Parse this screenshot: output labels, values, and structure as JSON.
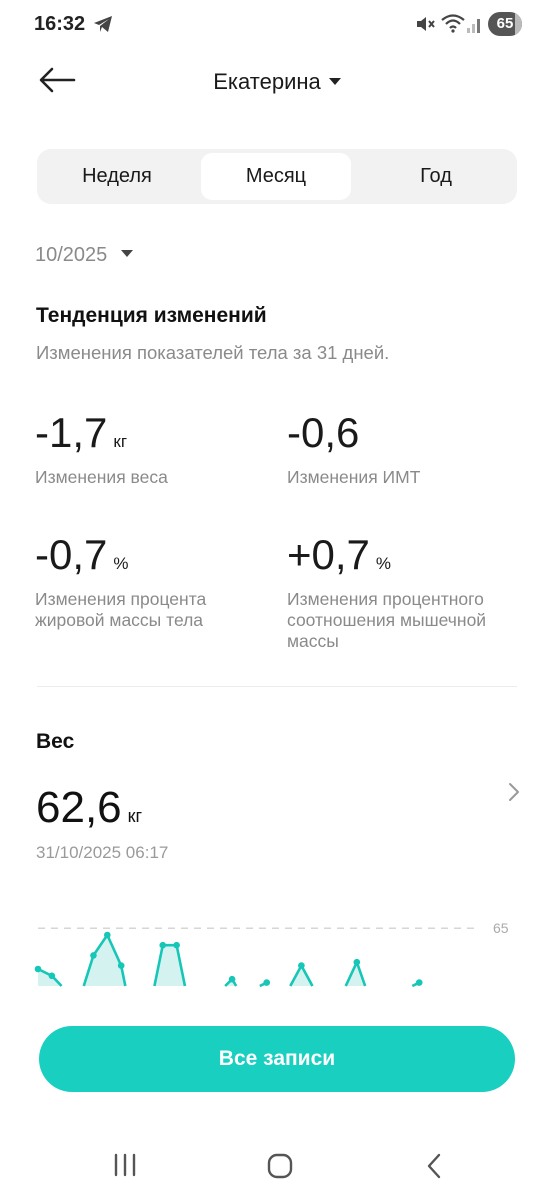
{
  "status": {
    "time": "16:32",
    "battery": "65",
    "icons": [
      "telegram-icon",
      "mute-icon",
      "wifi-icon",
      "signal-icon",
      "battery-icon"
    ]
  },
  "header": {
    "profile_name": "Екатерина",
    "icons": [
      "arrow-left-icon",
      "caret-down-icon"
    ]
  },
  "tabs": [
    {
      "label": "Неделя",
      "active": false
    },
    {
      "label": "Месяц",
      "active": true
    },
    {
      "label": "Год",
      "active": false
    }
  ],
  "period": {
    "label": "10/2025"
  },
  "trend": {
    "title": "Тенденция изменений",
    "subtitle": "Изменения показателей тела за 31 дней.",
    "metrics": [
      {
        "value": "-1,7",
        "unit": "кг",
        "label": "Изменения веса"
      },
      {
        "value": "-0,6",
        "unit": "",
        "label": "Изменения ИМТ"
      },
      {
        "value": "-0,7",
        "unit": "%",
        "label": "Изменения процента жировой массы тела"
      },
      {
        "value": "+0,7",
        "unit": "%",
        "label": "Изменения процентного соотношения мышечной массы"
      }
    ]
  },
  "weight": {
    "title": "Вес",
    "value": "62,6",
    "unit": "кг",
    "date": "31/10/2025 06:17",
    "reference_label": "65"
  },
  "chart_data": {
    "type": "area",
    "reference_line": 65,
    "y_tick_labels": [
      "65"
    ],
    "segments": [
      [
        [
          1,
          63.8
        ],
        [
          2,
          63.6
        ],
        [
          2.7,
          63.3
        ]
      ],
      [
        [
          4.3,
          63.3
        ],
        [
          5,
          64.2
        ],
        [
          6,
          64.8
        ],
        [
          7,
          63.9
        ],
        [
          7.3,
          63.3
        ]
      ],
      [
        [
          9.4,
          63.3
        ],
        [
          10,
          64.5
        ],
        [
          11,
          64.5
        ],
        [
          11.6,
          63.3
        ]
      ],
      [
        [
          14.5,
          63.3
        ],
        [
          15,
          63.5
        ],
        [
          15.3,
          63.3
        ]
      ],
      [
        [
          17,
          63.3
        ],
        [
          17.5,
          63.4
        ]
      ],
      [
        [
          19.2,
          63.3
        ],
        [
          20,
          63.9
        ],
        [
          20.8,
          63.3
        ]
      ],
      [
        [
          23.2,
          63.3
        ],
        [
          24,
          64.0
        ],
        [
          24.6,
          63.3
        ]
      ],
      [
        [
          28,
          63.3
        ],
        [
          28.5,
          63.4
        ]
      ]
    ],
    "y_range": [
      63.3,
      65.3
    ],
    "x_range": [
      1,
      30
    ],
    "line_color": "#16c6b6",
    "fill_color": "#d4f3f0"
  },
  "actions": {
    "all_records": "Все записи"
  },
  "nav": {
    "icons": [
      "recents-icon",
      "home-icon",
      "back-icon"
    ]
  },
  "colors": {
    "accent": "#19cfc0",
    "muted": "#8a8a8a"
  }
}
